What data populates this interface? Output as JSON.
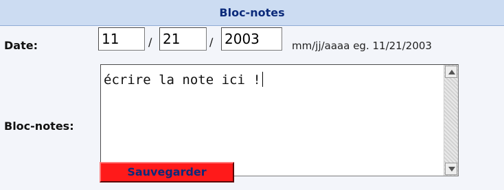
{
  "window": {
    "title": "Bloc-notes"
  },
  "form": {
    "date_label": "Date:",
    "notes_label": "Bloc-notes:",
    "date": {
      "month_value": "11",
      "day_value": "21",
      "year_value": "2003",
      "separator": "/",
      "hint": "mm/jj/aaaa eg. 11/21/2003"
    },
    "notes": {
      "value": "écrire la note ici !"
    },
    "save_label": "Sauvegarder"
  },
  "colors": {
    "header_bg": "#ccdcf2",
    "panel_bg": "#f3f5fa",
    "title_text": "#0b2a7a",
    "button_bg": "#ff1a1a"
  },
  "icons": {
    "scroll_up": "scroll-up-arrow-icon",
    "scroll_down": "scroll-down-arrow-icon"
  }
}
